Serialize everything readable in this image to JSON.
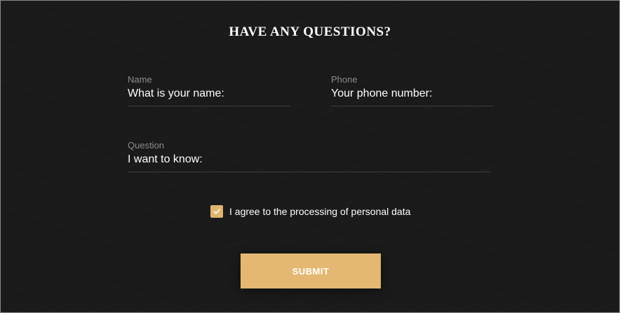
{
  "form": {
    "title": "HAVE ANY QUESTIONS?",
    "name": {
      "label": "Name",
      "placeholder": "What is your name:"
    },
    "phone": {
      "label": "Phone",
      "placeholder": "Your phone number:"
    },
    "question": {
      "label": "Question",
      "placeholder": "I want to know:"
    },
    "consent": {
      "checked": true,
      "label": "I agree to the processing of personal data",
      "icon": "check-icon"
    },
    "submit_label": "SUBMIT"
  },
  "colors": {
    "background": "#1a1a1a",
    "accent": "#e4b872",
    "label": "#8c8c8c",
    "text": "#ffffff",
    "divider": "#3d3d3d"
  }
}
